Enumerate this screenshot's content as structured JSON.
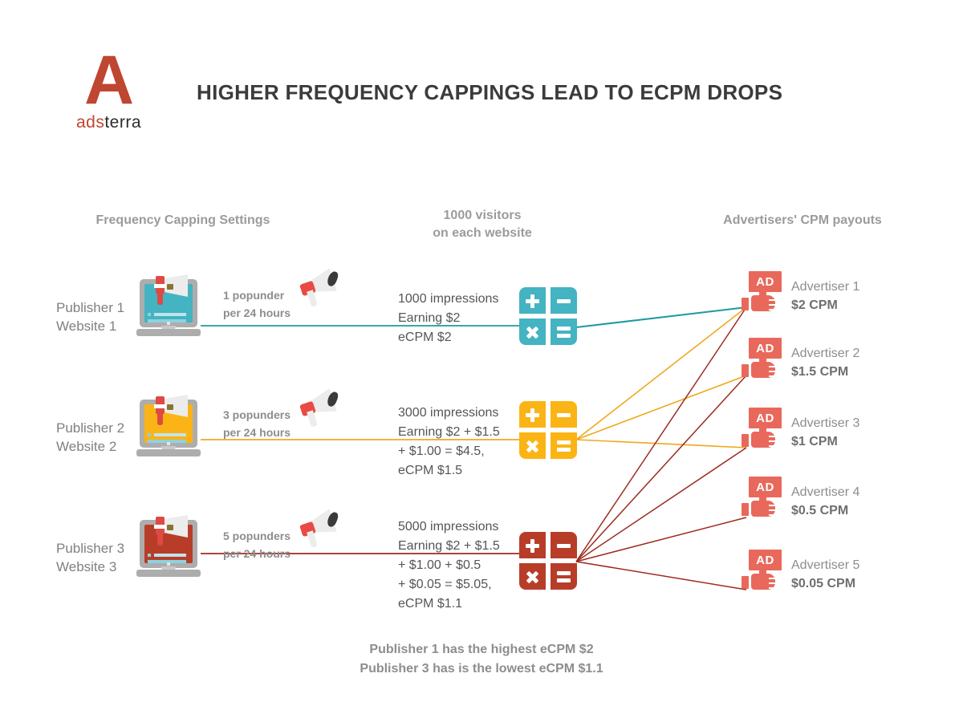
{
  "brand": {
    "logo_letter": "A",
    "logo_word_part1": "ads",
    "logo_word_part2": "terra",
    "accent_red": "#bf4630"
  },
  "header": {
    "title": "HIGHER FREQUENCY CAPPINGS LEAD TO ECPM DROPS"
  },
  "columns": {
    "capping": "Frequency Capping Settings",
    "visitors_line1": "1000 visitors",
    "visitors_line2": "on each website",
    "payouts": "Advertisers' CPM payouts"
  },
  "rows": [
    {
      "publisher_line1": "Publisher 1",
      "publisher_line2": "Website 1",
      "capping_line1": "1 popunder",
      "capping_line2": "per 24 hours",
      "impressions_lines": [
        "1000  impressions",
        "Earning $2",
        "eCPM $2"
      ],
      "color": "#41b0bf",
      "screen_color": "#44b3c2",
      "line_color": "#1e9aa0"
    },
    {
      "publisher_line1": "Publisher 2",
      "publisher_line2": "Website 2",
      "capping_line1": "3 popunders",
      "capping_line2": "per 24 hours",
      "impressions_lines": [
        "3000 impressions",
        "Earning $2 + $1.5",
        "+ $1.00 = $4.5,",
        "eCPM $1.5"
      ],
      "color": "#fbb415",
      "screen_color": "#fbb415",
      "line_color": "#f0a81e"
    },
    {
      "publisher_line1": "Publisher 3",
      "publisher_line2": "Website 3",
      "capping_line1": "5 popunders",
      "capping_line2": "per 24 hours",
      "impressions_lines": [
        "5000 impressions",
        "Earning $2 + $1.5",
        "+ $1.00 + $0.5",
        "+ $0.05 = $5.05,",
        "eCPM $1.1"
      ],
      "color": "#b83d29",
      "screen_color": "#b83d29",
      "line_color": "#9e2b1e"
    }
  ],
  "advertisers": [
    {
      "name": "Advertiser 1",
      "cpm": "$2 CPM",
      "badge": "AD"
    },
    {
      "name": "Advertiser 2",
      "cpm": "$1.5 CPM",
      "badge": "AD"
    },
    {
      "name": "Advertiser 3",
      "cpm": "$1 CPM",
      "badge": "AD"
    },
    {
      "name": "Advertiser 4",
      "cpm": "$0.5 CPM",
      "badge": "AD"
    },
    {
      "name": "Advertiser 5",
      "cpm": "$0.05 CPM",
      "badge": "AD"
    }
  ],
  "footer": {
    "line1": "Publisher 1 has the highest eCPM $2",
    "line2": "Publisher 3 has is the lowest eCPM $1.1"
  },
  "icons": {
    "calculator_plus": "+",
    "calculator_minus": "−",
    "calculator_times": "×",
    "calculator_equals": "="
  }
}
